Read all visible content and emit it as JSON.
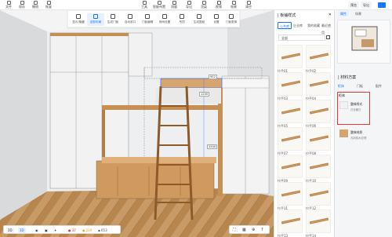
{
  "toolbar": {
    "left_items": [
      "文件",
      "保存",
      "撤销",
      "恢复"
    ],
    "center_items": [
      "工具",
      "智能布置",
      "测量",
      "导出",
      "渲染",
      "视频",
      "效果",
      "清空"
    ],
    "right_labels": [
      "预览",
      "导出",
      "分享"
    ]
  },
  "subbar": {
    "items": [
      "显示/隐藏",
      "定制布局",
      "生成门板",
      "自动收口",
      "门板编辑",
      "房间设置",
      "吊顶",
      "生成图纸",
      "设置",
      "门板更换"
    ],
    "active_index": 1
  },
  "panel": {
    "title": "| 板铺样式",
    "tabs": [
      "公共库",
      "企业库",
      "我的收藏",
      "最近使用"
    ],
    "active_tab": 0,
    "dropdown_value": "全部",
    "items": [
      "拉手01",
      "拉手02",
      "拉手03",
      "拉手04",
      "拉手05",
      "拉手06",
      "拉手07",
      "拉手08",
      "拉手09",
      "拉手10",
      "拉手11",
      "拉手12",
      "拉手13",
      "拉手14"
    ],
    "pager": {
      "prev": "<",
      "current": "1",
      "sep": "/",
      "total": "2",
      ">": ">"
    }
  },
  "props": {
    "top_tabs": [
      "属性",
      "场景"
    ],
    "active_top": 0,
    "section_title": "| 材料方案",
    "sub_tabs": [
      "柜体",
      "门板",
      "配件"
    ],
    "active_sub": 0,
    "item1_head": "柜体",
    "item1_name": "整体样式",
    "item1_desc": "白色暖白",
    "item2_name": "整体材质",
    "item2_desc": "浅胡桃木纹理"
  },
  "scene": {
    "dim_top": "952",
    "dim_right": "1200",
    "dim_side": "1500"
  },
  "bottom": {
    "mode_2d": "2D",
    "mode_3d": "3D",
    "stat_a": "37",
    "stat_b": "289",
    "stat_c": "653",
    "accent": "#1677ff"
  }
}
